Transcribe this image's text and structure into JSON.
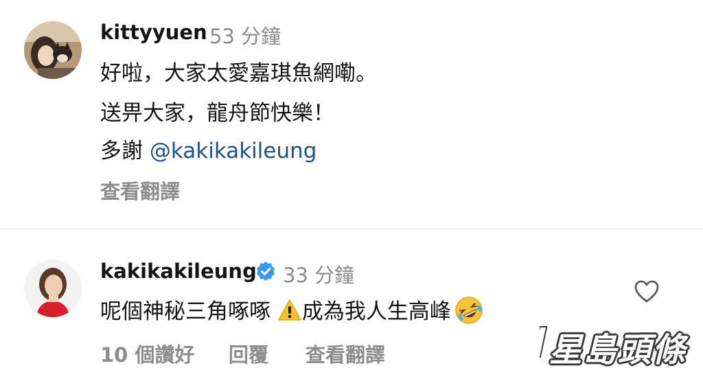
{
  "comments": [
    {
      "username": "kittyyuen",
      "time": "53 分鐘",
      "lines": [
        "好啦，大家太愛嘉琪魚網嘞。",
        "送畀大家，龍舟節快樂！"
      ],
      "thanks_prefix": "多謝 ",
      "mention": "@kakikakileung",
      "translate_label": "查看翻譯",
      "avatar_icon": "avatar-photo-with-dog"
    },
    {
      "username": "kakikakileung",
      "verified_icon": "verified-badge-icon",
      "time": "33 分鐘",
      "text_part1": "呢個神秘三角啄啄",
      "warning_icon": "warning-emoji",
      "text_part2": "成為我人生高峰",
      "rofl_icon": "rolling-on-floor-laughing-emoji",
      "likes_label": "10 個讚好",
      "reply_label": "回覆",
      "translate_label": "查看翻譯",
      "like_icon": "heart-icon",
      "avatar_icon": "avatar-photo"
    }
  ],
  "watermark": {
    "text": "星島頭條"
  },
  "colors": {
    "mention": "#1e4f8f",
    "verified": "#3897f0",
    "secondary_text": "#8a8a8a"
  }
}
